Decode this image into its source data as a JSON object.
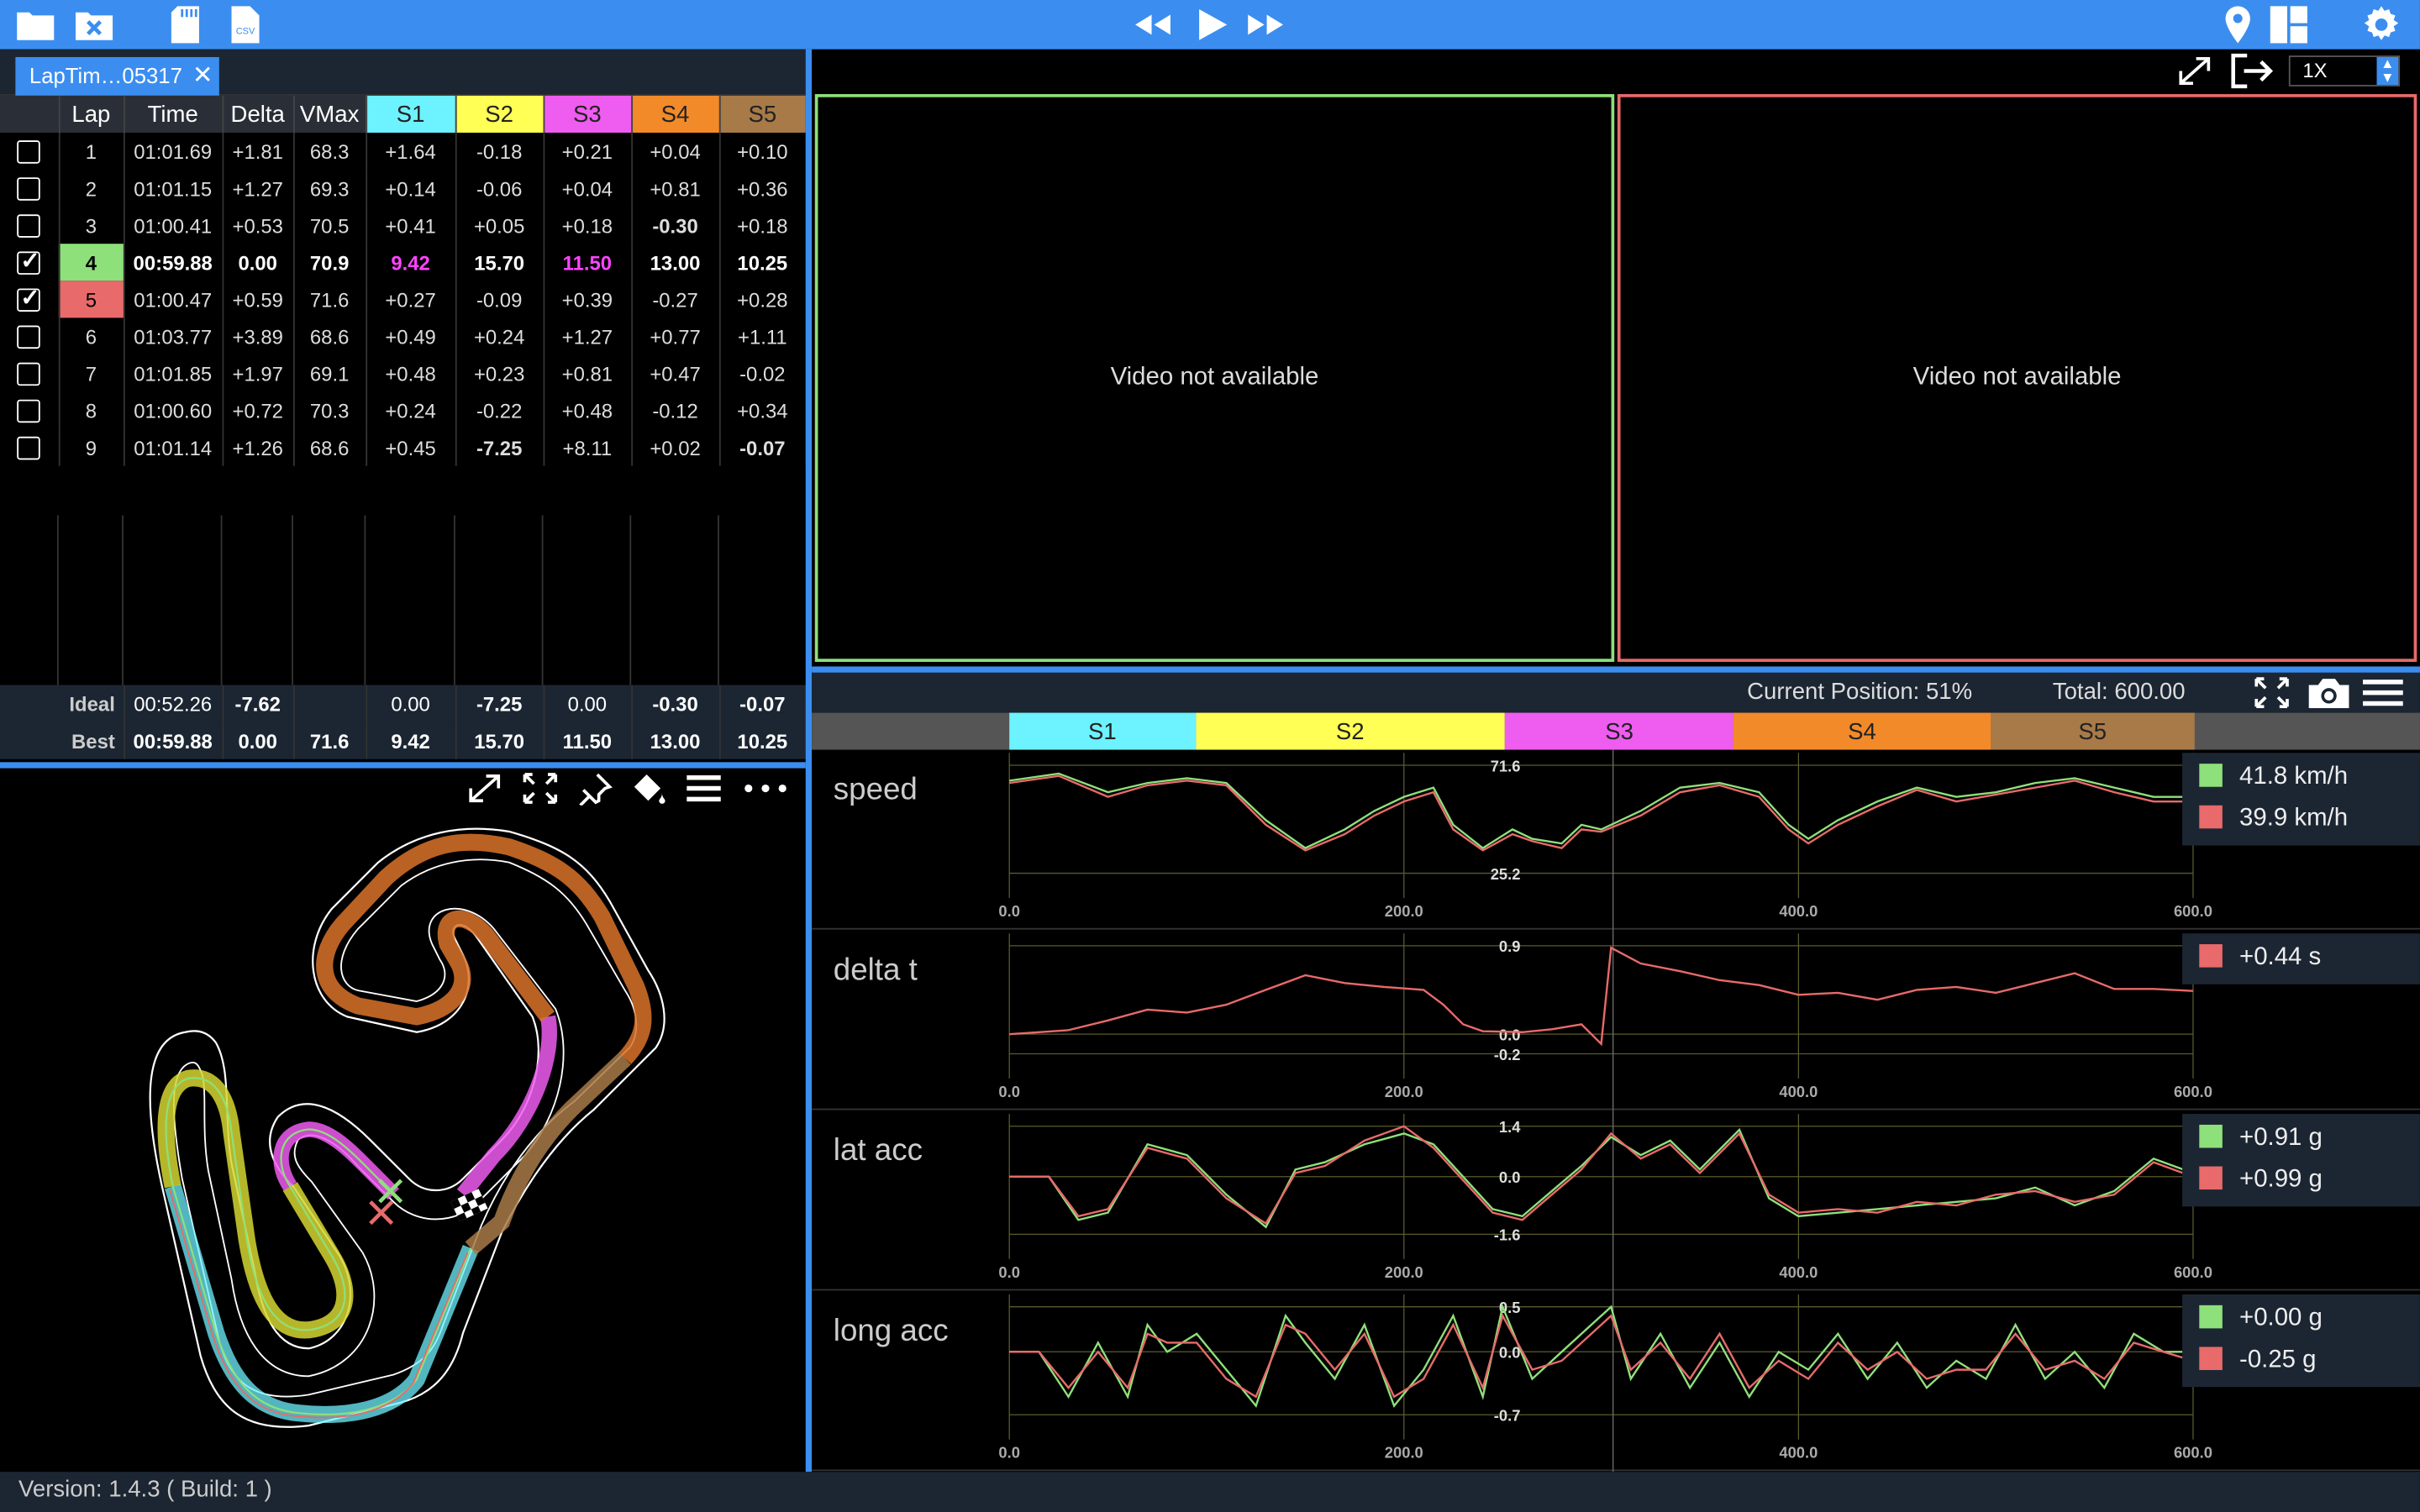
{
  "toolbar": {
    "left_icons": [
      "folder-open-icon",
      "folder-close-icon",
      "sd-card-icon",
      "csv-file-icon"
    ],
    "csv_label": "CSV",
    "center_icons": [
      "rewind-icon",
      "play-icon",
      "fast-forward-icon"
    ],
    "right_icons": [
      "map-pin-icon",
      "layout-grid-icon",
      "gear-icon"
    ]
  },
  "file_tab": {
    "label": "LapTim…05317"
  },
  "laps_table": {
    "headers": [
      "",
      "Lap",
      "Time",
      "Delta",
      "VMax",
      "S1",
      "S2",
      "S3",
      "S4",
      "S5"
    ],
    "header_colors": {
      "S1": "#6df2ff",
      "S2": "#ffff55",
      "S3": "#ef5cf0",
      "S4": "#f28a2a",
      "S5": "#a87a48"
    },
    "rows": [
      {
        "checked": false,
        "lap": "1",
        "time": "01:01.69",
        "delta": "+1.81",
        "vmax": "68.3",
        "s1": "+1.64",
        "s2": "-0.18",
        "s3": "+0.21",
        "s4": "+0.04",
        "s5": "+0.10"
      },
      {
        "checked": false,
        "lap": "2",
        "time": "01:01.15",
        "delta": "+1.27",
        "vmax": "69.3",
        "s1": "+0.14",
        "s2": "-0.06",
        "s3": "+0.04",
        "s4": "+0.81",
        "s5": "+0.36"
      },
      {
        "checked": false,
        "lap": "3",
        "time": "01:00.41",
        "delta": "+0.53",
        "vmax": "70.5",
        "s1": "+0.41",
        "s2": "+0.05",
        "s3": "+0.18",
        "s4": "-0.30",
        "s5": "+0.18"
      },
      {
        "checked": true,
        "lap": "4",
        "time": "00:59.88",
        "delta": "0.00",
        "vmax": "70.9",
        "s1": "9.42",
        "s2": "15.70",
        "s3": "11.50",
        "s4": "13.00",
        "s5": "10.25"
      },
      {
        "checked": true,
        "lap": "5",
        "time": "01:00.47",
        "delta": "+0.59",
        "vmax": "71.6",
        "s1": "+0.27",
        "s2": "-0.09",
        "s3": "+0.39",
        "s4": "-0.27",
        "s5": "+0.28"
      },
      {
        "checked": false,
        "lap": "6",
        "time": "01:03.77",
        "delta": "+3.89",
        "vmax": "68.6",
        "s1": "+0.49",
        "s2": "+0.24",
        "s3": "+1.27",
        "s4": "+0.77",
        "s5": "+1.11"
      },
      {
        "checked": false,
        "lap": "7",
        "time": "01:01.85",
        "delta": "+1.97",
        "vmax": "69.1",
        "s1": "+0.48",
        "s2": "+0.23",
        "s3": "+0.81",
        "s4": "+0.47",
        "s5": "-0.02"
      },
      {
        "checked": false,
        "lap": "8",
        "time": "01:00.60",
        "delta": "+0.72",
        "vmax": "70.3",
        "s1": "+0.24",
        "s2": "-0.22",
        "s3": "+0.48",
        "s4": "-0.12",
        "s5": "+0.34"
      },
      {
        "checked": false,
        "lap": "9",
        "time": "01:01.14",
        "delta": "+1.26",
        "vmax": "68.6",
        "s1": "+0.45",
        "s2": "-7.25",
        "s3": "+8.11",
        "s4": "+0.02",
        "s5": "-0.07"
      }
    ],
    "ideal": {
      "label": "Ideal",
      "time": "00:52.26",
      "delta": "-7.62",
      "vmax": "",
      "s1": "0.00",
      "s2": "-7.25",
      "s3": "0.00",
      "s4": "-0.30",
      "s5": "-0.07"
    },
    "best": {
      "label": "Best",
      "time": "00:59.88",
      "delta": "0.00",
      "vmax": "71.6",
      "s1": "9.42",
      "s2": "15.70",
      "s3": "11.50",
      "s4": "13.00",
      "s5": "10.25"
    }
  },
  "map_toolbar": {
    "icons": [
      "expand-icon",
      "fullscreen-icon",
      "pin-icon",
      "paint-bucket-icon",
      "menu-icon",
      "more-icon"
    ]
  },
  "video": {
    "speed_label": "1X",
    "panel_1_text": "Video not available",
    "panel_2_text": "Video not available"
  },
  "chart_header": {
    "current_position": "Current Position: 51%",
    "total": "Total: 600.00"
  },
  "sectors": [
    {
      "label": "S1",
      "color": "#6df2ff",
      "start": 0,
      "end": 56.5
    },
    {
      "label": "S2",
      "color": "#ffff55",
      "start": 56.5,
      "end": 150.5
    },
    {
      "label": "S3",
      "color": "#ef5cf0",
      "start": 150.5,
      "end": 220
    },
    {
      "label": "S4",
      "color": "#f28a2a",
      "start": 220,
      "end": 298
    },
    {
      "label": "S5",
      "color": "#a87a48",
      "start": 298,
      "end": 360
    }
  ],
  "colors": {
    "lap4": "#8ee07a",
    "lap5": "#e86a6a",
    "accent": "#3b8ef0"
  },
  "chart_data": [
    {
      "type": "line",
      "title": "speed",
      "xlim": [
        0,
        600
      ],
      "ylim": [
        25.2,
        71.6
      ],
      "x_ticks": [
        "0.0",
        "200.0",
        "400.0",
        "600.0"
      ],
      "y_ticks": [
        "71.6",
        "25.2"
      ],
      "legend": [
        "41.8 km/h",
        "39.9 km/h"
      ],
      "series": [
        {
          "color": "#8ee07a",
          "x": [
            0,
            25,
            50,
            70,
            90,
            110,
            130,
            150,
            170,
            185,
            200,
            215,
            225,
            240,
            255,
            265,
            280,
            290,
            300,
            320,
            340,
            360,
            380,
            395,
            405,
            420,
            440,
            460,
            480,
            500,
            520,
            540,
            560,
            580,
            600
          ],
          "y": [
            65,
            68,
            60,
            64,
            66,
            64,
            48,
            36,
            44,
            52,
            58,
            62,
            46,
            36,
            44,
            40,
            38,
            46,
            44,
            52,
            62,
            64,
            60,
            46,
            40,
            48,
            56,
            62,
            58,
            60,
            64,
            66,
            62,
            58,
            58
          ]
        },
        {
          "color": "#e86a6a",
          "x": [
            0,
            25,
            50,
            70,
            90,
            110,
            130,
            150,
            170,
            185,
            200,
            215,
            225,
            240,
            255,
            265,
            280,
            290,
            300,
            320,
            340,
            360,
            380,
            395,
            405,
            420,
            440,
            460,
            480,
            500,
            520,
            540,
            560,
            580,
            600
          ],
          "y": [
            64,
            67,
            58,
            63,
            65,
            63,
            46,
            35,
            42,
            50,
            56,
            60,
            44,
            35,
            42,
            39,
            36,
            44,
            43,
            50,
            60,
            63,
            58,
            44,
            38,
            46,
            54,
            61,
            56,
            59,
            62,
            65,
            60,
            56,
            56
          ]
        }
      ]
    },
    {
      "type": "line",
      "title": "delta t",
      "xlim": [
        0,
        600
      ],
      "ylim": [
        -0.2,
        0.9
      ],
      "x_ticks": [
        "0.0",
        "200.0",
        "400.0",
        "600.0"
      ],
      "y_ticks": [
        "0.9",
        "0.0",
        "-0.2"
      ],
      "legend": [
        "+0.44 s"
      ],
      "series": [
        {
          "color": "#e86a6a",
          "x": [
            0,
            30,
            50,
            70,
            90,
            110,
            130,
            150,
            170,
            190,
            210,
            220,
            230,
            240,
            260,
            275,
            290,
            300,
            305,
            320,
            340,
            360,
            380,
            400,
            420,
            440,
            460,
            480,
            500,
            520,
            540,
            560,
            580,
            600
          ],
          "y": [
            0.0,
            0.04,
            0.14,
            0.25,
            0.22,
            0.3,
            0.45,
            0.6,
            0.52,
            0.48,
            0.45,
            0.3,
            0.1,
            0.03,
            0.02,
            0.05,
            0.1,
            -0.1,
            0.88,
            0.72,
            0.64,
            0.55,
            0.5,
            0.4,
            0.42,
            0.35,
            0.45,
            0.48,
            0.42,
            0.52,
            0.62,
            0.46,
            0.46,
            0.44
          ]
        }
      ]
    },
    {
      "type": "line",
      "title": "lat acc",
      "xlim": [
        0,
        600
      ],
      "ylim": [
        -1.6,
        1.4
      ],
      "x_ticks": [
        "0.0",
        "200.0",
        "400.0",
        "600.0"
      ],
      "y_ticks": [
        "1.4",
        "0.0",
        "-1.6"
      ],
      "legend": [
        "+0.91 g",
        "+0.99 g"
      ],
      "series": [
        {
          "color": "#8ee07a",
          "x": [
            0,
            20,
            35,
            50,
            70,
            90,
            110,
            130,
            145,
            160,
            180,
            200,
            215,
            230,
            245,
            260,
            275,
            290,
            305,
            320,
            335,
            350,
            370,
            385,
            400,
            420,
            440,
            460,
            480,
            500,
            520,
            540,
            560,
            580,
            600
          ],
          "y": [
            0.0,
            0.0,
            -1.2,
            -1.0,
            0.9,
            0.6,
            -0.5,
            -1.4,
            0.2,
            0.4,
            0.9,
            1.2,
            0.9,
            0.0,
            -0.9,
            -1.1,
            -0.4,
            0.3,
            1.1,
            0.6,
            1.0,
            0.2,
            1.3,
            -0.6,
            -1.1,
            -1.0,
            -0.9,
            -0.8,
            -0.7,
            -0.6,
            -0.3,
            -0.8,
            -0.4,
            0.5,
            0.1
          ]
        },
        {
          "color": "#e86a6a",
          "x": [
            0,
            20,
            35,
            50,
            70,
            90,
            110,
            130,
            145,
            160,
            180,
            200,
            215,
            230,
            245,
            260,
            275,
            290,
            305,
            320,
            335,
            350,
            370,
            385,
            400,
            420,
            440,
            460,
            480,
            500,
            520,
            540,
            560,
            580,
            600
          ],
          "y": [
            0.0,
            0.0,
            -1.1,
            -0.9,
            0.8,
            0.5,
            -0.6,
            -1.3,
            0.1,
            0.3,
            1.0,
            1.4,
            0.8,
            -0.1,
            -1.0,
            -1.2,
            -0.5,
            0.2,
            1.2,
            0.5,
            0.9,
            0.1,
            1.2,
            -0.5,
            -1.0,
            -0.9,
            -1.0,
            -0.7,
            -0.8,
            -0.5,
            -0.4,
            -0.7,
            -0.5,
            0.4,
            0.0
          ]
        }
      ]
    },
    {
      "type": "line",
      "title": "long acc",
      "xlim": [
        0,
        600
      ],
      "ylim": [
        -0.7,
        0.5
      ],
      "x_ticks": [
        "0.0",
        "200.0",
        "400.0",
        "600.0"
      ],
      "y_ticks": [
        "0.5",
        "0.0",
        "-0.7"
      ],
      "legend": [
        "+0.00 g",
        "-0.25 g"
      ],
      "series": [
        {
          "color": "#8ee07a",
          "x": [
            0,
            15,
            30,
            45,
            60,
            70,
            80,
            95,
            110,
            125,
            140,
            150,
            165,
            180,
            195,
            210,
            225,
            240,
            250,
            265,
            280,
            295,
            305,
            315,
            330,
            345,
            360,
            375,
            390,
            405,
            420,
            435,
            450,
            465,
            480,
            495,
            510,
            525,
            540,
            555,
            570,
            585,
            600
          ],
          "y": [
            0.0,
            0.0,
            -0.5,
            0.1,
            -0.5,
            0.3,
            0.0,
            0.2,
            -0.2,
            -0.6,
            0.4,
            0.1,
            -0.3,
            0.3,
            -0.6,
            -0.2,
            0.4,
            -0.5,
            0.5,
            -0.3,
            0.0,
            0.3,
            0.5,
            -0.3,
            0.2,
            -0.4,
            0.1,
            -0.5,
            0.0,
            -0.2,
            0.2,
            -0.3,
            0.1,
            -0.4,
            -0.1,
            -0.3,
            0.3,
            -0.3,
            0.0,
            -0.4,
            0.2,
            0.0,
            0.0
          ]
        },
        {
          "color": "#e86a6a",
          "x": [
            0,
            15,
            30,
            45,
            60,
            70,
            80,
            95,
            110,
            125,
            140,
            150,
            165,
            180,
            195,
            210,
            225,
            240,
            250,
            265,
            280,
            295,
            305,
            315,
            330,
            345,
            360,
            375,
            390,
            405,
            420,
            435,
            450,
            465,
            480,
            495,
            510,
            525,
            540,
            555,
            570,
            585,
            600
          ],
          "y": [
            0.0,
            0.0,
            -0.4,
            0.0,
            -0.4,
            0.2,
            0.1,
            0.1,
            -0.3,
            -0.5,
            0.3,
            0.2,
            -0.2,
            0.2,
            -0.5,
            -0.3,
            0.3,
            -0.4,
            0.4,
            -0.2,
            -0.1,
            0.2,
            0.4,
            -0.2,
            0.1,
            -0.3,
            0.2,
            -0.4,
            -0.1,
            -0.3,
            0.1,
            -0.2,
            0.0,
            -0.3,
            -0.2,
            -0.2,
            0.2,
            -0.2,
            -0.1,
            -0.3,
            0.1,
            0.0,
            -0.1
          ]
        }
      ]
    }
  ],
  "status": {
    "version": "Version: 1.4.3 ( Build: 1 )"
  }
}
